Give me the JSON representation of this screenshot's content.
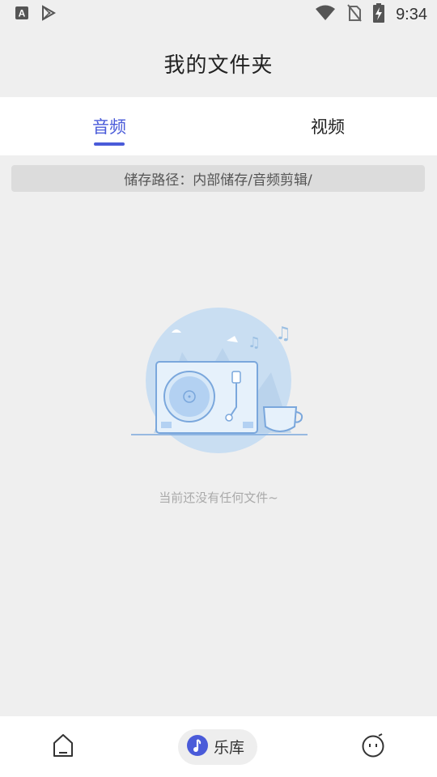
{
  "status_bar": {
    "time": "9:34",
    "icons": [
      "a-notification-icon",
      "play-store-icon",
      "wifi-icon",
      "no-sim-icon",
      "battery-charging-icon"
    ]
  },
  "header": {
    "title": "我的文件夹"
  },
  "tabs": [
    {
      "label": "音频",
      "active": true
    },
    {
      "label": "视频",
      "active": false
    }
  ],
  "storage_path": "储存路径：内部储存/音频剪辑/",
  "empty_state": {
    "message": "当前还没有任何文件~"
  },
  "bottom_nav": {
    "items": [
      {
        "icon": "home-icon",
        "label": ""
      },
      {
        "icon": "music-note-icon",
        "label": "乐库",
        "active": true
      },
      {
        "icon": "face-icon",
        "label": ""
      }
    ]
  },
  "colors": {
    "accent": "#4a5bd9",
    "background": "#efefef",
    "illustration": "#c9def2"
  }
}
